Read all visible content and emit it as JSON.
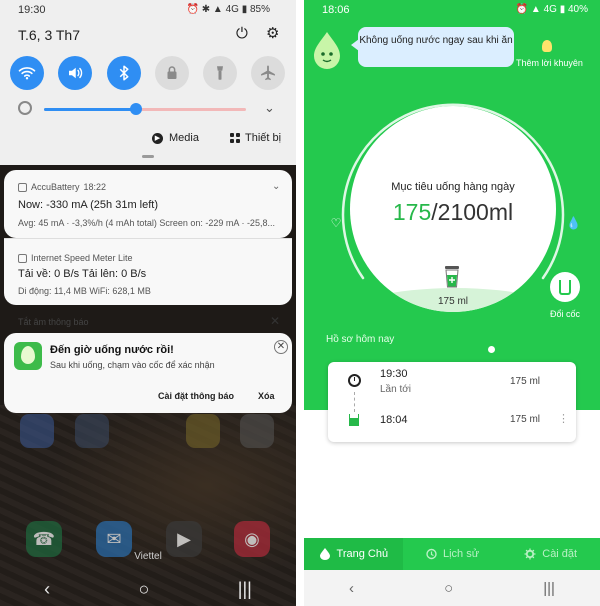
{
  "left": {
    "status": {
      "time": "19:30",
      "battery": "85%",
      "network": "4G"
    },
    "date": "T.6, 3 Th7",
    "icons": {
      "power": "power-icon",
      "settings": "gear-icon"
    },
    "quick_settings": [
      "wifi",
      "sound",
      "bluetooth",
      "lock-rotation",
      "flashlight",
      "airplane"
    ],
    "media_label": "Media",
    "devices_label": "Thiết bị",
    "notif1": {
      "app": "AccuBattery",
      "time": "18:22",
      "line1": "Now: -330 mA (25h 31m left)",
      "line2": "Avg: 45 mA · -3,3%/h (4 mAh total) Screen on: -229 mA · -25,8..."
    },
    "notif2": {
      "app": "Internet Speed Meter Lite",
      "line1": "Tải về: 0 B/s    Tải lên: 0 B/s",
      "line2": "Di động: 11,4 MB    WiFi: 628,1 MB"
    },
    "silent_header": "Tắt âm thông báo",
    "water_notif": {
      "title": "Đến giờ uống nước rồi!",
      "body": "Sau khi uống, chạm vào cốc để xác nhận",
      "action_settings": "Cài đặt thông báo",
      "action_delete": "Xóa"
    },
    "carrier": "Viettel"
  },
  "right": {
    "status": {
      "time": "18:06",
      "battery": "40%",
      "network": "4G"
    },
    "bubble": "Không uống nước ngay sau khi ăn",
    "tip_label": "Thêm lời khuyên",
    "goal_label": "Mục tiêu uống hàng ngày",
    "goal_current": "175",
    "goal_total": "/2100ml",
    "cup_amount": "175 ml",
    "switch_cup_label": "Đổi cốc",
    "history_label": "Hồ sơ hôm nay",
    "history": [
      {
        "time": "19:30",
        "note": "Lần tới",
        "amount": "175 ml"
      },
      {
        "time": "18:04",
        "note": "",
        "amount": "175 ml"
      }
    ],
    "tabs": [
      {
        "label": "Trang Chủ",
        "icon": "drop-icon",
        "active": true
      },
      {
        "label": "Lịch sử",
        "icon": "history-icon",
        "active": false
      },
      {
        "label": "Cài đặt",
        "icon": "gear-icon",
        "active": false
      }
    ],
    "colors": {
      "primary": "#24c94e",
      "accent": "#27b84a",
      "bubble": "#dbeeff"
    }
  }
}
